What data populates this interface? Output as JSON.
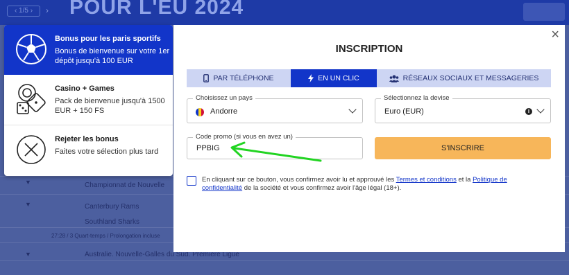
{
  "background": {
    "headline": "POUR L'EU 2024",
    "nav_left": "‹ 1/5 ›",
    "rows": [
      "Championnat de Nouvelle",
      "Canterbury Rams",
      "Southland Sharks",
      "27:28 / 3 Quart-temps / Prolongation incluse",
      "Australie. Nouvelle-Galles du Sud. Première Ligue"
    ]
  },
  "bonus": {
    "items": [
      {
        "title": "Bonus pour les paris sportifs",
        "desc": "Bonus de bienvenue sur votre 1er dépôt jusqu'à 100 EUR",
        "icon": "soccer-ball-icon"
      },
      {
        "title": "Casino + Games",
        "desc": "Pack de bienvenue jusqu'à 1500 EUR + 150 FS",
        "icon": "casino-chips-dice-icon"
      },
      {
        "title": "Rejeter les bonus",
        "desc": "Faites votre sélection plus tard",
        "icon": "reject-x-icon"
      }
    ]
  },
  "modal": {
    "close": "×",
    "title": "INSCRIPTION",
    "tabs": [
      {
        "label": "PAR TÉLÉPHONE",
        "icon": "phone-icon"
      },
      {
        "label": "EN UN CLIC",
        "icon": "lightning-icon"
      },
      {
        "label": "RÉSEAUX SOCIAUX ET MESSAGERIES",
        "icon": "users-icon"
      }
    ],
    "country": {
      "label": "Choisissez un pays",
      "value": "Andorre"
    },
    "currency": {
      "label": "Sélectionnez la devise",
      "value": "Euro (EUR)"
    },
    "promo": {
      "label": "Code promo (si vous en avez un)",
      "value": "PPBIG"
    },
    "submit": "S'INSCRIRE",
    "consent": {
      "part1": "En cliquant sur ce bouton, vous confirmez avoir lu et approuvé les ",
      "link1": "Termes et conditions",
      "part2": " et la ",
      "link2": "Politique de confidentialité",
      "part3": " de la société et vous confirmez avoir l'âge légal (18+)."
    }
  },
  "colors": {
    "accent": "#1235c9",
    "submit": "#f7b65a",
    "arrow": "#22d422"
  }
}
